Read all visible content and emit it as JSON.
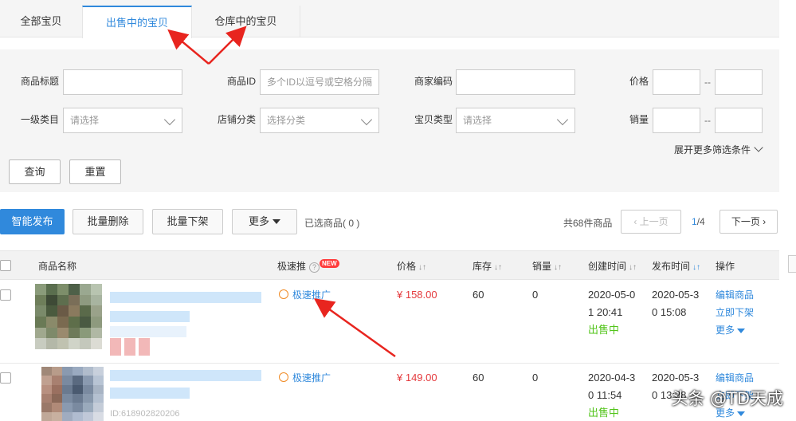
{
  "tabs": [
    {
      "label": "全部宝贝"
    },
    {
      "label": "出售中的宝贝"
    },
    {
      "label": "仓库中的宝贝"
    }
  ],
  "filters": {
    "product_title_label": "商品标题",
    "product_id_label": "商品ID",
    "product_id_placeholder": "多个ID以逗号或空格分隔",
    "merchant_code_label": "商家编码",
    "price_label": "价格",
    "category_label": "一级类目",
    "category_value": "请选择",
    "shop_category_label": "店铺分类",
    "shop_category_value": "选择分类",
    "item_type_label": "宝贝类型",
    "item_type_value": "请选择",
    "sales_label": "销量",
    "range_sep": "--",
    "more_filters": "展开更多筛选条件",
    "query_button": "查询",
    "reset_button": "重置"
  },
  "toolbar": {
    "smart_publish": "智能发布",
    "batch_delete": "批量删除",
    "batch_offshelf": "批量下架",
    "more": "更多",
    "selected": "已选商品( 0 )",
    "total": "共68件商品",
    "prev_page": "上一页",
    "page_current": "1",
    "page_total": "/4",
    "next_page": "下一页"
  },
  "table": {
    "headers": {
      "name": "商品名称",
      "promo": "极速推",
      "new_badge": "NEW",
      "price": "价格",
      "stock": "库存",
      "sales": "销量",
      "created": "创建时间",
      "published": "发布时间",
      "actions": "操作"
    },
    "rows": [
      {
        "promo": "极速推广",
        "price": "¥ 158.00",
        "stock": "60",
        "sales": "0",
        "created_1": "2020-05-0",
        "created_2": "1 20:41",
        "status": "出售中",
        "published_1": "2020-05-3",
        "published_2": "0 15:08",
        "action_edit": "编辑商品",
        "action_offshelf": "立即下架",
        "action_more": "更多"
      },
      {
        "promo": "极速推广",
        "price": "¥ 149.00",
        "stock": "60",
        "sales": "0",
        "created_1": "2020-04-3",
        "created_2": "0 11:54",
        "status": "出售中",
        "published_1": "2020-05-3",
        "published_2": "0 13:28",
        "action_edit": "编辑商品",
        "action_offshelf": "立即下架",
        "action_more": "更多",
        "product_id": "ID:618902820206"
      }
    ]
  },
  "watermark": "头条 @TD天成",
  "colors": {
    "accent": "#3089dc",
    "price": "#e4393c",
    "status": "#52c41a",
    "annotation_arrow": "#e8251f"
  }
}
